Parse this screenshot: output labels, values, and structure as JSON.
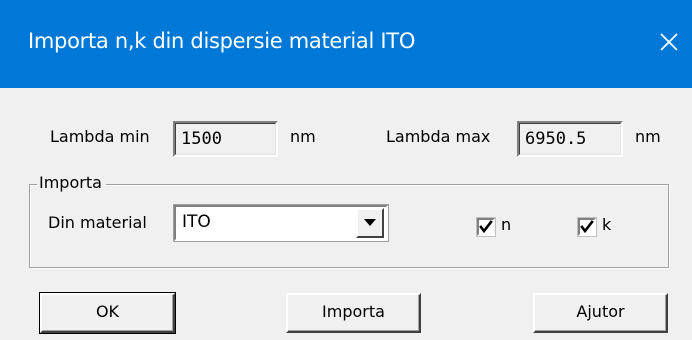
{
  "window": {
    "title": "Importa n,k din dispersie material ITO"
  },
  "lambda_min": {
    "label": "Lambda min",
    "value": "1500",
    "unit": "nm"
  },
  "lambda_max": {
    "label": "Lambda max",
    "value": "6950.5",
    "unit": "nm"
  },
  "import_group": {
    "title": "Importa",
    "material_label": "Din material",
    "material_value": "ITO",
    "check_n": {
      "label": "n",
      "checked": true
    },
    "check_k": {
      "label": "k",
      "checked": true
    }
  },
  "buttons": {
    "ok": "OK",
    "import": "Importa",
    "help": "Ajutor"
  },
  "colors": {
    "titlebar": "#0078d7",
    "background": "#f0f0f0"
  },
  "icons": {
    "close": "close-icon",
    "dropdown": "chevron-down-icon",
    "check": "check-icon"
  }
}
